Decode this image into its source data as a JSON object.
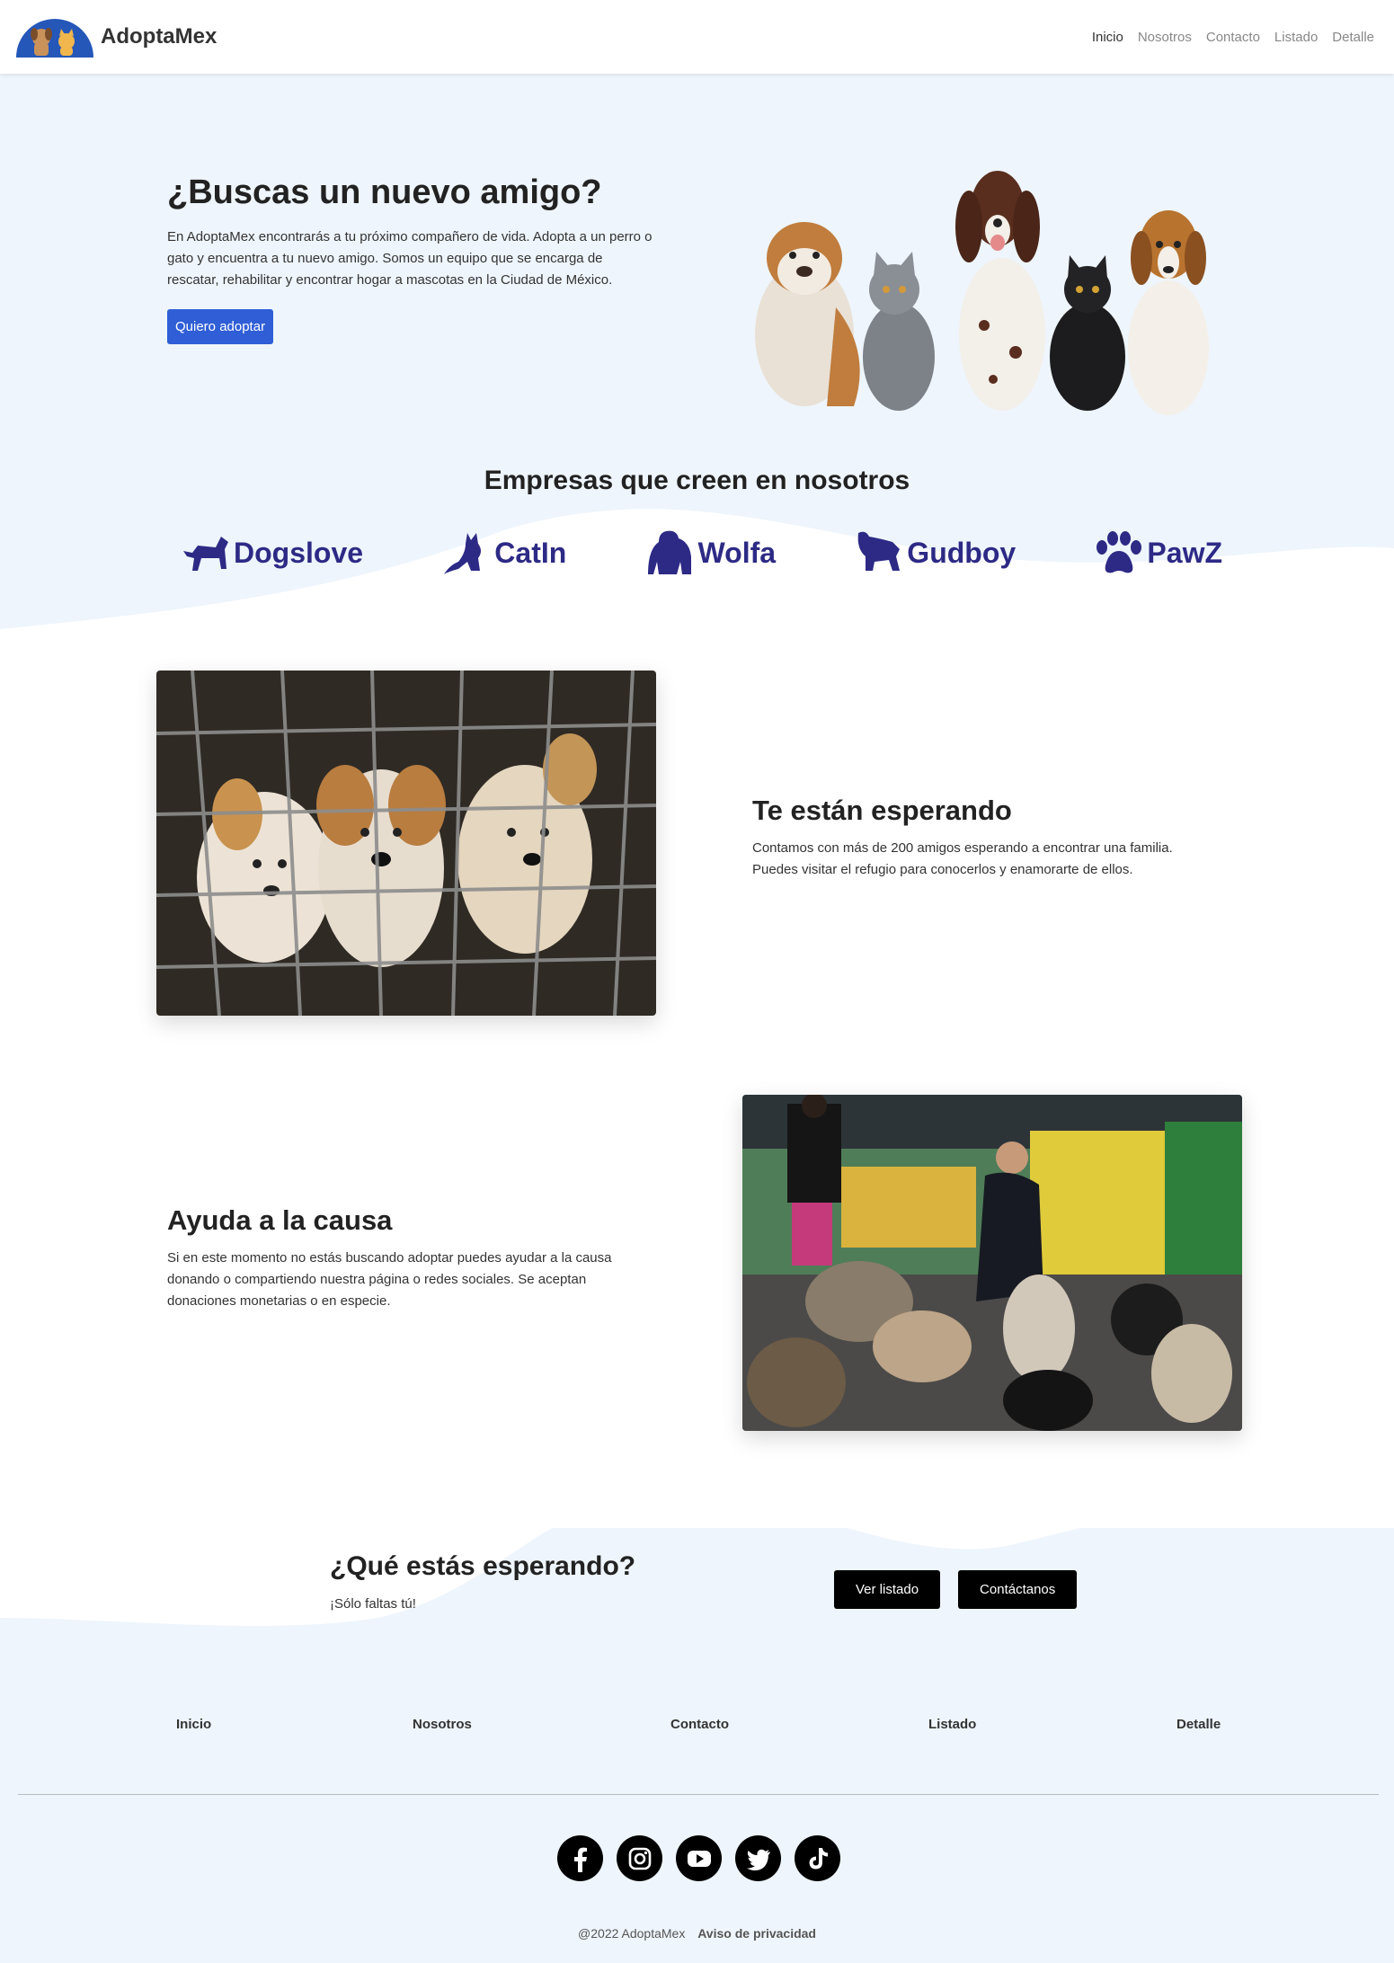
{
  "brand": {
    "name": "AdoptaMex"
  },
  "nav": {
    "items": [
      {
        "label": "Inicio",
        "active": true
      },
      {
        "label": "Nosotros"
      },
      {
        "label": "Contacto"
      },
      {
        "label": "Listado"
      },
      {
        "label": "Detalle"
      }
    ]
  },
  "hero": {
    "title": "¿Buscas un nuevo amigo?",
    "description": "En AdoptaMex encontrarás a tu próximo compañero de vida. Adopta a un perro o gato y encuentra a tu nuevo amigo. Somos un equipo que se encarga de rescatar, rehabilitar y encontrar hogar a mascotas en la Ciudad de México.",
    "button": "Quiero adoptar"
  },
  "sponsors": {
    "title": "Empresas que creen en nosotros",
    "items": [
      {
        "name": "Dogslove",
        "icon": "dog-icon"
      },
      {
        "name": "CatIn",
        "icon": "cat-icon"
      },
      {
        "name": "Wolfa",
        "icon": "gorilla-icon"
      },
      {
        "name": "Gudboy",
        "icon": "dog-icon"
      },
      {
        "name": "PawZ",
        "icon": "paw-icon"
      }
    ],
    "color": "#2d2a86"
  },
  "features": [
    {
      "title": "Te están esperando",
      "description": "Contamos con más de 200 amigos esperando a encontrar una familia. Puedes visitar el refugio para conocerlos y enamorarte de ellos."
    },
    {
      "title": "Ayuda a la causa",
      "description": "Si en este momento no estás buscando adoptar puedes ayudar a la causa donando o compartiendo nuestra página o redes sociales. Se aceptan donaciones monetarias o en especie."
    }
  ],
  "cta": {
    "title": "¿Qué estás esperando?",
    "subtitle": "¡Sólo faltas tú!",
    "buttons": [
      "Ver listado",
      "Contáctanos"
    ]
  },
  "footer": {
    "links": [
      "Inicio",
      "Nosotros",
      "Contacto",
      "Listado",
      "Detalle"
    ],
    "socials": [
      "facebook-icon",
      "instagram-icon",
      "youtube-icon",
      "twitter-icon",
      "tiktok-icon"
    ],
    "copyright": "@2022 AdoptaMex",
    "privacy": "Aviso de privacidad"
  },
  "colors": {
    "accent": "#2f5ed6",
    "background": "#eef5fc",
    "dark_button": "#000000"
  }
}
